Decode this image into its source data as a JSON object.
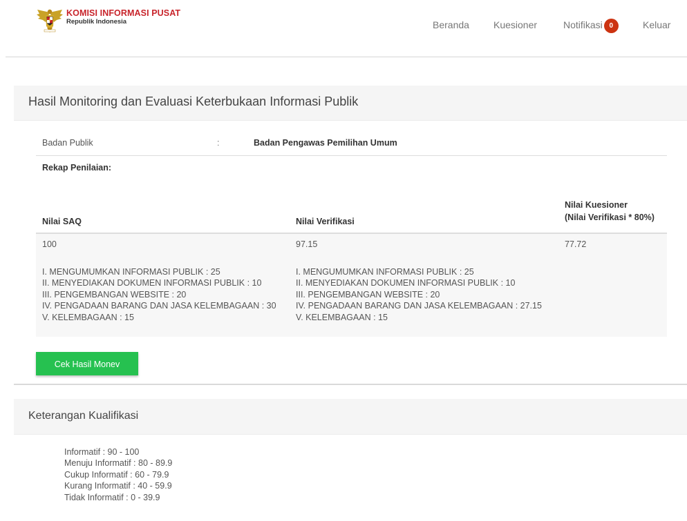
{
  "header": {
    "brand_title": "KOMISI INFORMASI PUSAT",
    "brand_subtitle": "Republik Indonesia",
    "nav": {
      "home": "Beranda",
      "questionnaire": "Kuesioner",
      "notification": "Notifikasi",
      "notification_count": "0",
      "logout": "Keluar"
    }
  },
  "result_card": {
    "title": "Hasil Monitoring dan Evaluasi Keterbukaan Informasi Publik",
    "body_label": "Badan Publik",
    "colon": ":",
    "body_value": "Badan Pengawas Pemilihan Umum",
    "rekap_label": "Rekap Penilaian:",
    "columns": {
      "saq": "Nilai SAQ",
      "verification": "Nilai Verifikasi",
      "questionnaire_line1": "Nilai Kuesioner",
      "questionnaire_line2": "(Nilai Verifikasi * 80%)"
    },
    "values": {
      "saq": "100",
      "verification": "97.15",
      "questionnaire": "77.72"
    },
    "saq_breakdown": [
      "I. MENGUMUMKAN INFORMASI PUBLIK : 25",
      "II. MENYEDIAKAN DOKUMEN INFORMASI PUBLIK : 10",
      "III. PENGEMBANGAN WEBSITE : 20",
      "IV. PENGADAAN BARANG DAN JASA KELEMBAGAAN : 30",
      "V. KELEMBAGAAN : 15"
    ],
    "verification_breakdown": [
      "I. MENGUMUMKAN INFORMASI PUBLIK : 25",
      "II. MENYEDIAKAN DOKUMEN INFORMASI PUBLIK : 10",
      "III. PENGEMBANGAN WEBSITE : 20",
      "IV. PENGADAAN BARANG DAN JASA KELEMBAGAAN : 27.15",
      "V. KELEMBAGAAN : 15"
    ],
    "button_label": "Cek Hasil Monev"
  },
  "qualification_card": {
    "title": "Keterangan Kualifikasi",
    "items": [
      "Informatif : 90 - 100",
      "Menuju Informatif : 80 - 89.9",
      "Cukup Informatif : 60 - 79.9",
      "Kurang Informatif : 40 - 59.9",
      "Tidak Informatif : 0 - 39.9"
    ]
  },
  "colors": {
    "brand_red": "#c8242b",
    "badge": "#cc3311",
    "button_green": "#26c150",
    "panel_gray": "#f5f5f5"
  }
}
